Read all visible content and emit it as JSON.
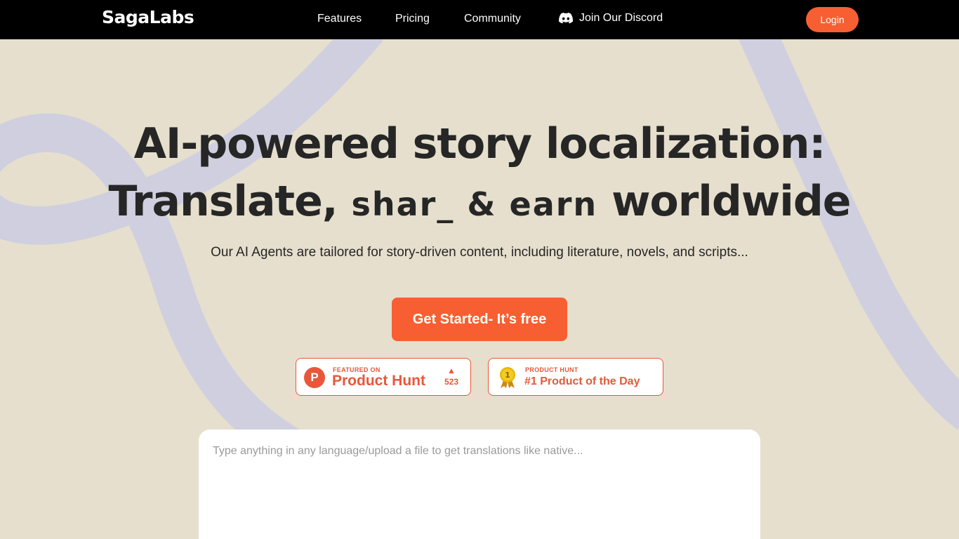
{
  "nav": {
    "logo": "SagaLabs",
    "links": [
      "Features",
      "Pricing",
      "Community"
    ],
    "discord_label": "Join Our Discord",
    "login_label": "Login"
  },
  "hero": {
    "headline_line1": "AI-powered story localization:",
    "headline_line2_start": "Translate,",
    "headline_line2_anim": "shar_ & earn",
    "headline_line2_end": "worldwide",
    "subtitle": "Our AI Agents are tailored for story-driven content, including literature, novels, and scripts...",
    "cta_label": "Get Started- It’s free"
  },
  "badges": {
    "product_hunt": {
      "small": "FEATURED ON",
      "big": "Product Hunt",
      "icon_letter": "P",
      "votes": "523"
    },
    "product_of_day": {
      "small": "PRODUCT HUNT",
      "big": "#1 Product of the Day",
      "medal_number": "1"
    }
  },
  "input": {
    "placeholder": "Type anything in any language/upload a file to get translations like native..."
  },
  "colors": {
    "accent": "#f75f33",
    "background": "#e6dfcd",
    "deco_lines": "#cfcfe0",
    "nav": "#000000"
  }
}
